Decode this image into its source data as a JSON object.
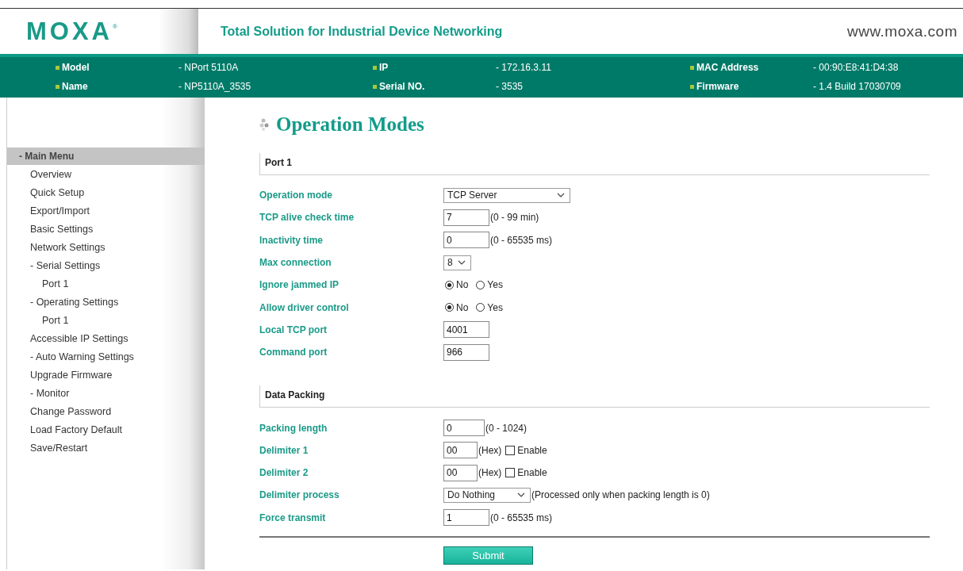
{
  "header": {
    "logo": "MOXA",
    "trademark": "®",
    "tagline": "Total Solution for Industrial Device Networking",
    "website": "www.moxa.com"
  },
  "device_info": [
    {
      "label": "Model",
      "value": "- NPort 5110A"
    },
    {
      "label": "Name",
      "value": "- NP5110A_3535"
    },
    {
      "label": "IP",
      "value": "- 172.16.3.11"
    },
    {
      "label": "Serial NO.",
      "value": "- 3535"
    },
    {
      "label": "MAC Address",
      "value": "- 00:90:E8:41:D4:38"
    },
    {
      "label": "Firmware",
      "value": "- 1.4 Build 17030709"
    }
  ],
  "sidebar": {
    "title": "- Main Menu",
    "items": [
      {
        "label": "Overview"
      },
      {
        "label": "Quick Setup"
      },
      {
        "label": "Export/Import"
      },
      {
        "label": "Basic Settings"
      },
      {
        "label": "Network Settings"
      },
      {
        "label": "- Serial Settings",
        "children": [
          {
            "label": "Port 1"
          }
        ]
      },
      {
        "label": "- Operating Settings",
        "children": [
          {
            "label": "Port 1"
          }
        ]
      },
      {
        "label": "Accessible IP Settings"
      },
      {
        "label": "- Auto Warning Settings"
      },
      {
        "label": "Upgrade Firmware"
      },
      {
        "label": "- Monitor"
      },
      {
        "label": "Change Password"
      },
      {
        "label": "Load Factory Default"
      },
      {
        "label": "Save/Restart"
      }
    ]
  },
  "page_title": "Operation Modes",
  "sections": [
    {
      "title": "Port 1",
      "rows": [
        {
          "label": "Operation mode",
          "kind": "select",
          "value": "TCP Server"
        },
        {
          "label": "TCP alive check time",
          "kind": "text",
          "value": "7",
          "hint": "(0 - 99 min)"
        },
        {
          "label": "Inactivity time",
          "kind": "text",
          "value": "0",
          "hint": "(0 - 65535 ms)"
        },
        {
          "label": "Max connection",
          "kind": "select",
          "value": "8"
        },
        {
          "label": "Ignore jammed IP",
          "kind": "radio",
          "options": [
            {
              "label": "No",
              "selected": true
            },
            {
              "label": "Yes",
              "selected": false
            }
          ]
        },
        {
          "label": "Allow driver control",
          "kind": "radio",
          "options": [
            {
              "label": "No",
              "selected": true
            },
            {
              "label": "Yes",
              "selected": false
            }
          ]
        },
        {
          "label": "Local TCP port",
          "kind": "text",
          "value": "4001"
        },
        {
          "label": "Command port",
          "kind": "text",
          "value": "966"
        }
      ]
    },
    {
      "title": "Data Packing",
      "rows": [
        {
          "label": "Packing length",
          "kind": "text",
          "value": "0",
          "hint": "(0 - 1024)"
        },
        {
          "label": "Delimiter 1",
          "kind": "text",
          "value": "00",
          "hint": "(Hex)",
          "checkbox": {
            "label": "Enable",
            "checked": false
          }
        },
        {
          "label": "Delimiter 2",
          "kind": "text",
          "value": "00",
          "hint": "(Hex)",
          "checkbox": {
            "label": "Enable",
            "checked": false
          }
        },
        {
          "label": "Delimiter process",
          "kind": "select",
          "value": "Do Nothing",
          "hint": "(Processed only when packing length is 0)"
        },
        {
          "label": "Force transmit",
          "kind": "text",
          "value": "1",
          "hint": "(0 - 65535 ms)"
        }
      ]
    }
  ],
  "submit": "Submit"
}
